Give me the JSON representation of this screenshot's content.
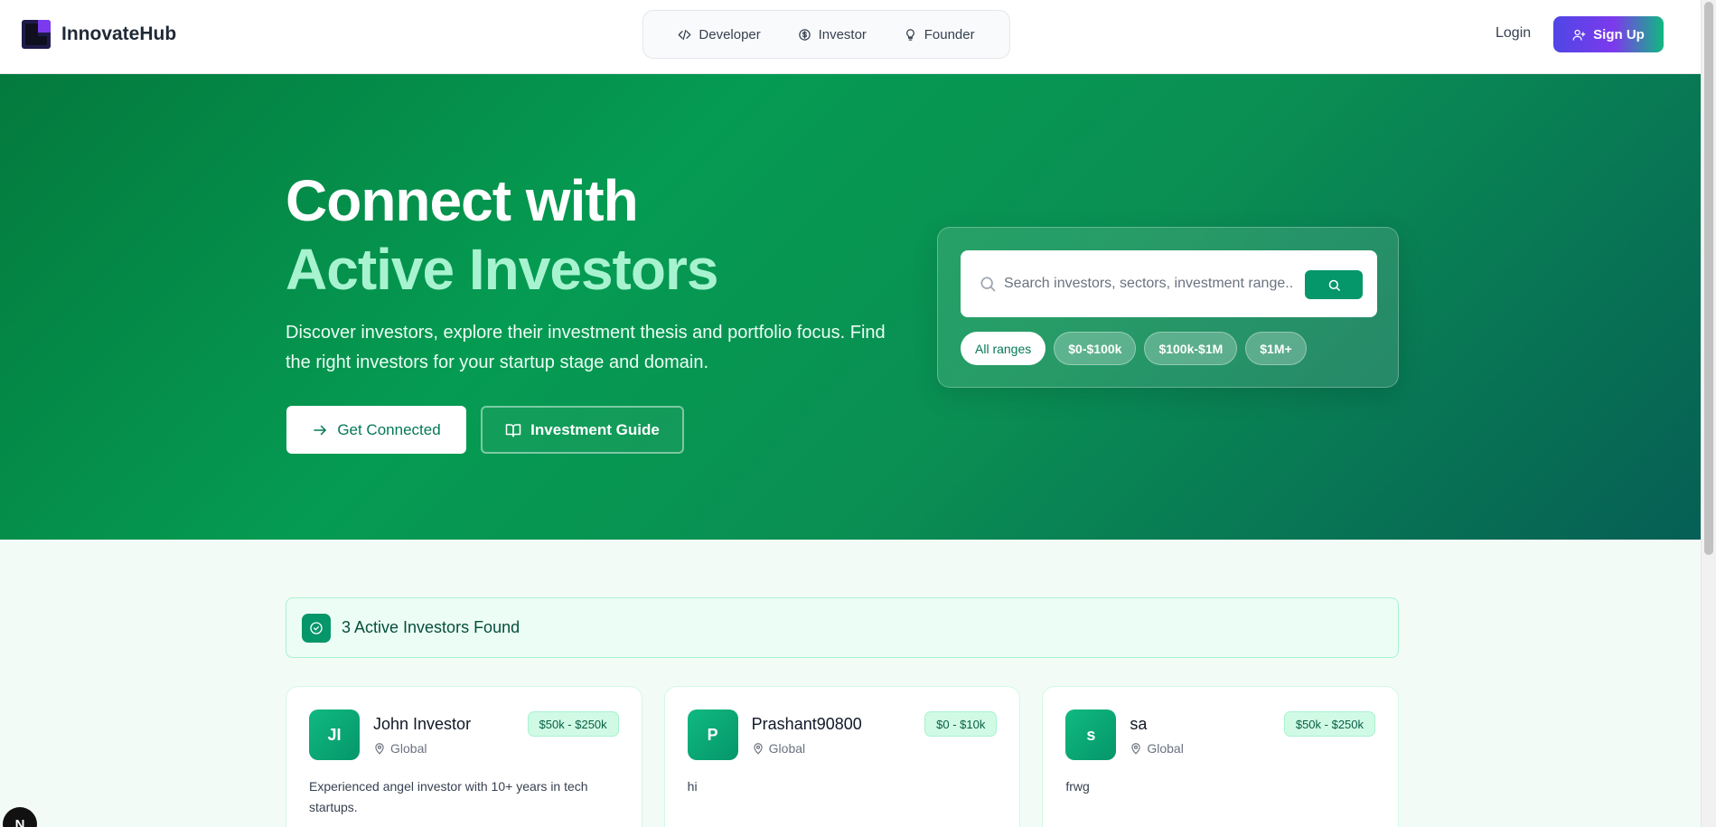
{
  "brand": {
    "name": "InnovateHub"
  },
  "nav": {
    "links": [
      {
        "label": "Developer",
        "icon": "code-icon"
      },
      {
        "label": "Investor",
        "icon": "dollar-circle-icon"
      },
      {
        "label": "Founder",
        "icon": "lightbulb-icon"
      }
    ],
    "login": "Login",
    "signup": "Sign Up"
  },
  "hero": {
    "title_line1": "Connect with",
    "title_line2": "Active Investors",
    "subtitle": "Discover investors, explore their investment thesis and portfolio focus. Find the right investors for your startup stage and domain.",
    "primary_button": "Get Connected",
    "secondary_button": "Investment Guide"
  },
  "search": {
    "placeholder": "Search investors, sectors, investment range...",
    "ranges": [
      "All ranges",
      "$0-$100k",
      "$100k-$1M",
      "$1M+"
    ],
    "selected_range": "All ranges"
  },
  "results": {
    "summary": "3 Active Investors Found",
    "investors": [
      {
        "initials": "JI",
        "name": "John Investor",
        "location": "Global",
        "range": "$50k - $250k",
        "description": "Experienced angel investor with 10+ years in tech startups."
      },
      {
        "initials": "P",
        "name": "Prashant90800",
        "location": "Global",
        "range": "$0 - $10k",
        "description": "hi"
      },
      {
        "initials": "s",
        "name": "sa",
        "location": "Global",
        "range": "$50k - $250k",
        "description": "frwg"
      }
    ]
  },
  "dev_badge": "N",
  "colors": {
    "primary": "#059669",
    "hero_dark": "#047a3d",
    "accent_text": "#a7f3d0",
    "signup_start": "#4f46e5",
    "signup_mid": "#7c3aed"
  }
}
